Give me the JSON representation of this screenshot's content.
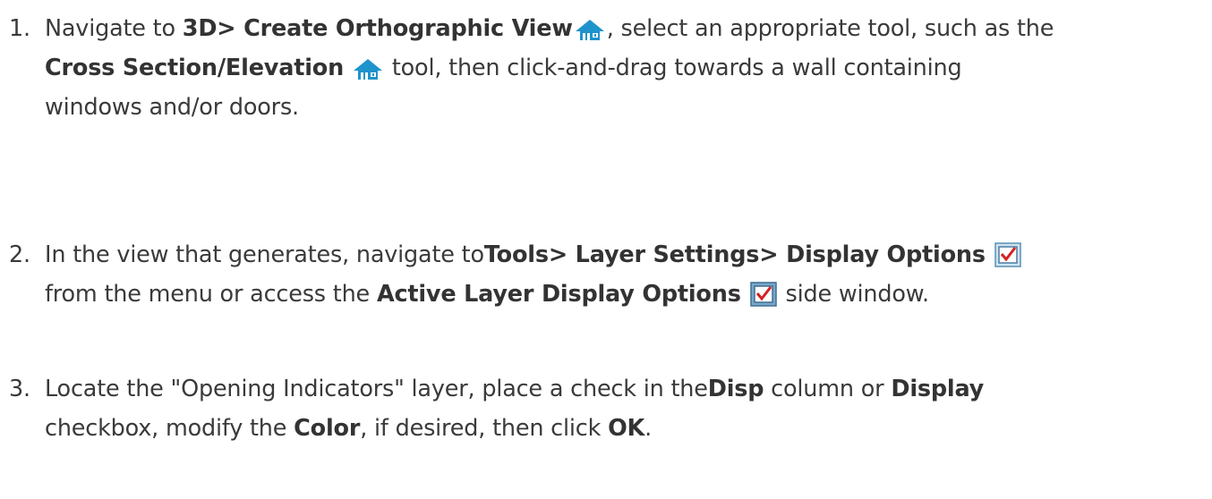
{
  "steps": [
    {
      "number": "1.",
      "l1_a": "Navigate to ",
      "l1_b": "3D> Create Orthographic View",
      "l1_c": ", select an appropriate tool, such as the",
      "l2_a": "Cross Section/Elevation",
      "l2_b": " tool, then click-and-drag towards a wall containing",
      "l3_a": "windows and/or doors.",
      "icon": "house-elevation-icon",
      "accent_color": "#1e90c8"
    },
    {
      "number": "2.",
      "l1_a": "In the view that generates, navigate to",
      "l1_b": "Tools> Layer Settings> Display Options",
      "l2_a": "from the menu or access the ",
      "l2_b": "Active Layer Display Options",
      "l2_c": " side window.",
      "icon": "display-options-checkbox-icon",
      "accent_color": "#d42020"
    },
    {
      "number": "3.",
      "l1_a": "Locate the \"Opening Indicators\" layer, place a check in the",
      "l1_b": "Disp",
      "l1_c": " column or ",
      "l1_d": "Display",
      "l2_a": "checkbox, modify the ",
      "l2_b": "Color",
      "l2_c": ", if desired, then click ",
      "l2_d": "OK",
      "l2_e": "."
    }
  ]
}
